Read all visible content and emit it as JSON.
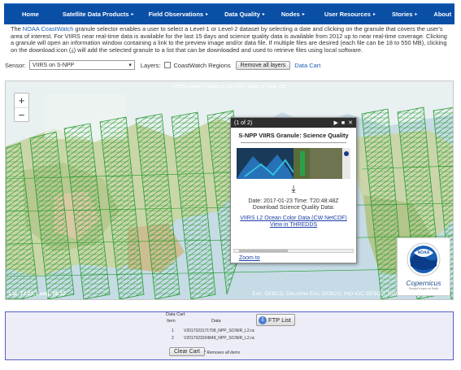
{
  "nav": {
    "items": [
      {
        "label": "Home",
        "dropdown": false
      },
      {
        "label": "Satellite Data Products",
        "dropdown": true
      },
      {
        "label": "Field Observations",
        "dropdown": true
      },
      {
        "label": "Data Quality",
        "dropdown": true
      },
      {
        "label": "Nodes",
        "dropdown": true
      },
      {
        "label": "User Resources",
        "dropdown": true
      },
      {
        "label": "Stories",
        "dropdown": true
      },
      {
        "label": "About",
        "dropdown": false
      }
    ]
  },
  "intro": {
    "pre": "The ",
    "link": "NOAA CoastWatch",
    "post": " granule selector enables a user to select a Level-1 or Level-2 dataset by selecting a date and clicking on the granule that covers the user's area of interest. For VIIRS near real-time data is available for the last 15 days and science quality data is available from 2012 up to near real-time coverage. Clicking a granule will open an information window containing a link to the preview image and/or data file. If multiple files are desired (each file can be 18 to 550 MB), clicking on the download icon (⤓) will add the selected granule to a list that can be downloaded and used to retrieve files using local software."
  },
  "controls": {
    "sensor_label": "Sensor:",
    "sensor_value": "VIIRS on S-NPP",
    "layers_label": "Layers:",
    "coastwatch_regions": "CoastWatch Regions",
    "remove_layers": "Remove all layers",
    "data_cart_link": "Data Cart"
  },
  "map": {
    "title": "VIIRS Level-2 Data 01-23-2017 (Day of Year 23)",
    "coords": "Lat: 74.03, Long: 36.10",
    "attribution": "Esri, GEBCO, DeLorme  Esri, GEBCO, IHO-IOC GEBCO, NGS",
    "zoom_in": "+",
    "zoom_out": "−"
  },
  "popup": {
    "counter": "(1 of 2)",
    "next": "▶",
    "maximize": "■",
    "close": "✕",
    "title": "S-NPP VIIRS Granule: Science Quality",
    "download_icon": "⤓",
    "date_line": "Date: 2017-01-23 Time: T20:48:48Z",
    "download_line": "Download Science Quality Data:",
    "link1": "VIIRS L2 Ocean Color Data (CW NetCDF)",
    "link2": "View in THREDDS",
    "zoom_link": "Zoom to"
  },
  "logos": {
    "noaa": "NOAA",
    "copernicus": "Copernicus",
    "copernicus_sub": "Europe's eyes on Earth"
  },
  "cart": {
    "title": "Data Cart",
    "col_item": "Item",
    "col_data": "Data",
    "rows": [
      {
        "item": "1",
        "data": "V2017023171708_NPP_SCINIR_L2.nc"
      },
      {
        "item": "2",
        "data": "V2017023204848_NPP_SCINIR_L2.nc"
      }
    ],
    "ftp_label": "FTP List",
    "clear_label": "Clear Cart",
    "clear_note": "* Removes all items"
  },
  "colors": {
    "nav_bg": "#0a4fa6",
    "granule_green": "#1f9a2a",
    "cart_border": "#5560c8"
  }
}
